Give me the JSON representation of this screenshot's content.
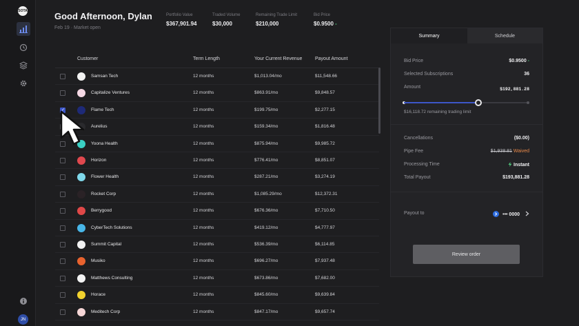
{
  "app": {
    "logo_text": "SOTA"
  },
  "sidebar": {
    "items": [
      {
        "icon": "bar-chart-icon",
        "active": true
      },
      {
        "icon": "history-icon",
        "active": false
      },
      {
        "icon": "layers-icon",
        "active": false
      },
      {
        "icon": "gear-icon",
        "active": false
      }
    ],
    "info_icon": "info-icon",
    "avatar_initials": "JN"
  },
  "header": {
    "greeting": "Good Afternoon, Dylan",
    "date": "Feb 19",
    "market_status": "Market open",
    "subtitle": "Feb 19 · Market open",
    "stats": [
      {
        "label": "Portfolio Value",
        "value": "$367,901.94",
        "suffix": ""
      },
      {
        "label": "Traded Volume",
        "value": "$30,000",
        "suffix": ""
      },
      {
        "label": "Remaining Trade Limit",
        "value": "$210,000",
        "suffix": ""
      },
      {
        "label": "Bid Price",
        "value": "$0.9500",
        "suffix": " -"
      }
    ]
  },
  "table": {
    "columns": [
      "Customer",
      "Term Length",
      "Your Current Revenue",
      "Payout Amount"
    ],
    "rows": [
      {
        "name": "Samsan Tech",
        "term": "12 months",
        "revenue": "$1,013.04/mo",
        "payout": "$11,548.66",
        "checked": false,
        "logo_color": "#f2f2f2"
      },
      {
        "name": "Capitalize Ventures",
        "term": "12 months",
        "revenue": "$863.91/mo",
        "payout": "$9,848.57",
        "checked": false,
        "logo_color": "#f5d8e4"
      },
      {
        "name": "Flame Tech",
        "term": "12 months",
        "revenue": "$199.75/mo",
        "payout": "$2,277.15",
        "checked": true,
        "logo_color": "#1e2a78"
      },
      {
        "name": "Aurelius",
        "term": "12 months",
        "revenue": "$159.34/mo",
        "payout": "$1,816.48",
        "checked": false,
        "logo_color": "#2a2a2d"
      },
      {
        "name": "Yoona Health",
        "term": "12 months",
        "revenue": "$875.94/mo",
        "payout": "$9,985.72",
        "checked": false,
        "logo_color": "#3ad0c4"
      },
      {
        "name": "Horizon",
        "term": "12 months",
        "revenue": "$776.41/mo",
        "payout": "$8,851.07",
        "checked": false,
        "logo_color": "#e0484e"
      },
      {
        "name": "Flower Health",
        "term": "12 months",
        "revenue": "$287.21/mo",
        "payout": "$3,274.19",
        "checked": false,
        "logo_color": "#7fd8ea"
      },
      {
        "name": "Rocket Corp",
        "term": "12 months",
        "revenue": "$1,085.29/mo",
        "payout": "$12,372.31",
        "checked": false,
        "logo_color": "#2a2226"
      },
      {
        "name": "Berrygood",
        "term": "12 months",
        "revenue": "$676.36/mo",
        "payout": "$7,710.50",
        "checked": false,
        "logo_color": "#e04848"
      },
      {
        "name": "CyberTech Solutions",
        "term": "12 months",
        "revenue": "$419.12/mo",
        "payout": "$4,777.97",
        "checked": false,
        "logo_color": "#48b6e8"
      },
      {
        "name": "Summit Capital",
        "term": "12 months",
        "revenue": "$536.39/mo",
        "payout": "$6,114.85",
        "checked": false,
        "logo_color": "#f2f2f2"
      },
      {
        "name": "Musiko",
        "term": "12 months",
        "revenue": "$696.27/mo",
        "payout": "$7,937.48",
        "checked": false,
        "logo_color": "#e8622e"
      },
      {
        "name": "Matthews Consulting",
        "term": "12 months",
        "revenue": "$673.86/mo",
        "payout": "$7,682.00",
        "checked": false,
        "logo_color": "#f2f2f2"
      },
      {
        "name": "Horace",
        "term": "12 months",
        "revenue": "$845.60/mo",
        "payout": "$9,639.84",
        "checked": false,
        "logo_color": "#f2d22e"
      },
      {
        "name": "Meditech Corp",
        "term": "12 months",
        "revenue": "$847.17/mo",
        "payout": "$9,657.74",
        "checked": false,
        "logo_color": "#f5d6d6"
      }
    ]
  },
  "panel": {
    "tabs": [
      {
        "label": "Summary",
        "active": true
      },
      {
        "label": "Schedule",
        "active": false
      }
    ],
    "bid_price_label": "Bid Price",
    "bid_price_value": "$0.9500",
    "bid_price_suffix": " -",
    "subscriptions_label": "Selected Subscriptions",
    "subscriptions_value": "36",
    "amount_label": "Amount",
    "amount_value": "$192,881.28",
    "slider_fraction": 0.6,
    "remaining_limit_text": "$16,118.72 remaining trading limit",
    "cancellations_label": "Cancellations",
    "cancellations_value": "($0.00)",
    "pipe_fee_label": "Pipe Fee",
    "pipe_fee_value": "$1,938.81",
    "pipe_fee_status": "Waived",
    "processing_label": "Processing Time",
    "processing_value": "Instant",
    "total_label": "Total Payout",
    "total_value": "$193,881.28",
    "payout_to_label": "Payout to",
    "payout_account": "••• 0000",
    "review_button": "Review order"
  },
  "colors": {
    "accent": "#3d57c9",
    "positive": "#4fc37a",
    "waived": "#e9894a"
  }
}
